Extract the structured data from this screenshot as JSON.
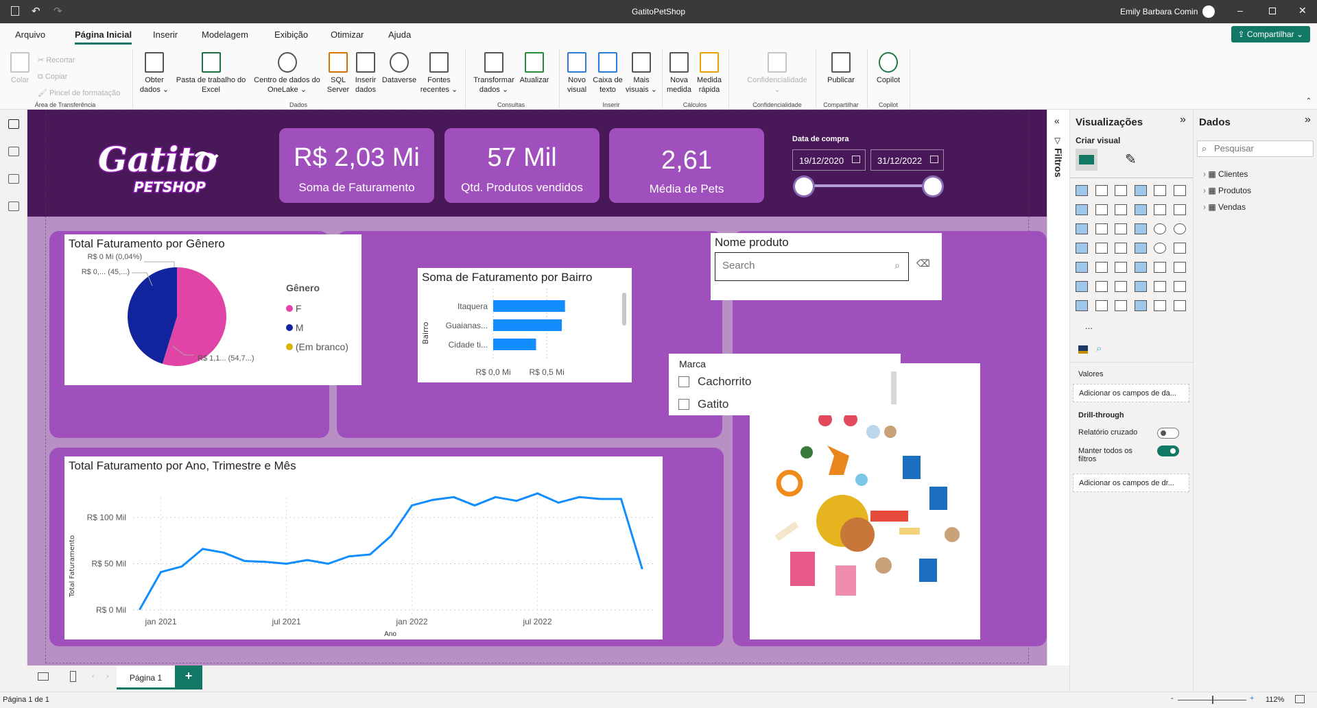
{
  "window": {
    "title": "GatitoPetShop",
    "user": "Emily Barbara Comin"
  },
  "menu": {
    "tabs": [
      "Arquivo",
      "Página Inicial",
      "Inserir",
      "Modelagem",
      "Exibição",
      "Otimizar",
      "Ajuda"
    ],
    "active": "Página Inicial",
    "share": "Compartilhar"
  },
  "ribbon": {
    "clipboard": {
      "paste": "Colar",
      "cut": "Recortar",
      "copy": "Copiar",
      "format_painter": "Pincel de formatação",
      "group": "Área de Transferência"
    },
    "data": {
      "get_data": "Obter dados",
      "excel": "Pasta de trabalho do Excel",
      "onelake": "Centro de dados do OneLake",
      "sql": "SQL Server",
      "enter_data": "Inserir dados",
      "dataverse": "Dataverse",
      "recent": "Fontes recentes",
      "group": "Dados"
    },
    "queries": {
      "transform": "Transformar dados",
      "refresh": "Atualizar",
      "group": "Consultas"
    },
    "insert": {
      "new_visual": "Novo visual",
      "text_box": "Caixa de texto",
      "more_visuals": "Mais visuais",
      "group": "Inserir"
    },
    "calc": {
      "new_measure": "Nova medida",
      "quick_measure": "Medida rápida",
      "group": "Cálculos"
    },
    "sensitivity": {
      "label": "Confidencialidade",
      "group": "Confidencialidade"
    },
    "share": {
      "publish": "Publicar",
      "group": "Compartilhar"
    },
    "copilot": {
      "label": "Copilot",
      "group": "Copilot"
    }
  },
  "report": {
    "logo_text": "Gatito PETSHOP",
    "kpis": [
      {
        "value": "R$ 2,03 Mi",
        "label": "Soma de Faturamento"
      },
      {
        "value": "57 Mil",
        "label": "Qtd. Produtos vendidos"
      },
      {
        "value": "2,61",
        "label": "Média de Pets"
      }
    ],
    "date_slicer": {
      "title": "Data de compra",
      "start": "19/12/2020",
      "end": "31/12/2022",
      "range_fraction": [
        0,
        1
      ]
    },
    "product_slicer": {
      "title": "Nome produto",
      "placeholder": "Search"
    },
    "brand_slicer": {
      "title": "Marca",
      "options": [
        {
          "label": "Cachorrito",
          "checked": false
        },
        {
          "label": "Gatito",
          "checked": false
        }
      ]
    }
  },
  "chart_data": [
    {
      "type": "pie",
      "title": "Total Faturamento por Gênero",
      "legend_title": "Gênero",
      "legend_position": "right",
      "slices": [
        {
          "name": "F",
          "percent": 54.7,
          "color": "#e044a7",
          "label": "R$ 1,1... (54,7...)"
        },
        {
          "name": "(Em branco)",
          "percent": 0.04,
          "color": "#d9b300",
          "label": "R$ 0 Mi (0,04%)"
        },
        {
          "name": "M",
          "percent": 45.26,
          "color": "#12239e",
          "label": "R$ 0,... (45,...)"
        }
      ]
    },
    {
      "type": "bar",
      "orientation": "horizontal",
      "title": "Soma de Faturamento por Bairro",
      "ylabel": "Bairro",
      "categories": [
        "Itaquera",
        "Guaianas...",
        "Cidade ti..."
      ],
      "values": [
        0.67,
        0.64,
        0.4
      ],
      "xticks": [
        "R$ 0,0 Mi",
        "R$ 0,5 Mi"
      ],
      "xlim": [
        0,
        0.8
      ],
      "color": "#118dff"
    },
    {
      "type": "line",
      "title": "Total Faturamento por Ano, Trimestre e Mês",
      "xlabel": "Ano",
      "ylabel": "Total Faturamento",
      "x": [
        "2020-12",
        "2021-01",
        "2021-02",
        "2021-03",
        "2021-04",
        "2021-05",
        "2021-06",
        "2021-07",
        "2021-08",
        "2021-09",
        "2021-10",
        "2021-11",
        "2021-12",
        "2022-01",
        "2022-02",
        "2022-03",
        "2022-04",
        "2022-05",
        "2022-06",
        "2022-07",
        "2022-08",
        "2022-09",
        "2022-10",
        "2022-11",
        "2022-12"
      ],
      "values": [
        1,
        41,
        47,
        66,
        62,
        53,
        52,
        50,
        54,
        50,
        58,
        60,
        80,
        113,
        119,
        122,
        113,
        122,
        118,
        126,
        116,
        122,
        120,
        120,
        45
      ],
      "unit": "Mil",
      "yticks": [
        "R$ 0 Mil",
        "R$ 50 Mil",
        "R$ 100 Mil"
      ],
      "ytick_values": [
        0,
        50,
        100
      ],
      "xticks": [
        "jan 2021",
        "jul 2021",
        "jan 2022",
        "jul 2022"
      ],
      "color": "#118dff",
      "grid": true
    }
  ],
  "filters_pane": {
    "label": "Filtros"
  },
  "visualizations": {
    "title": "Visualizações",
    "create": "Criar visual",
    "values": "Valores",
    "values_drop": "Adicionar os campos de da...",
    "drill": "Drill-through",
    "cross_report": "Relatório cruzado",
    "cross_report_on": false,
    "keep_filters": "Manter todos os filtros",
    "keep_filters_on": true,
    "drill_drop": "Adicionar os campos de dr...",
    "more": "..."
  },
  "data_pane": {
    "title": "Dados",
    "search_placeholder": "Pesquisar",
    "tables": [
      "Clientes",
      "Produtos",
      "Vendas"
    ]
  },
  "pages": {
    "tabs": [
      "Página 1"
    ],
    "add": "+"
  },
  "status": {
    "page": "Página 1 de 1",
    "zoom": "112%",
    "zoom_minus": "-",
    "zoom_plus": "+"
  },
  "colors": {
    "header": "#481858",
    "panel": "#a050bd",
    "accent": "#117865",
    "series": "#118dff"
  }
}
